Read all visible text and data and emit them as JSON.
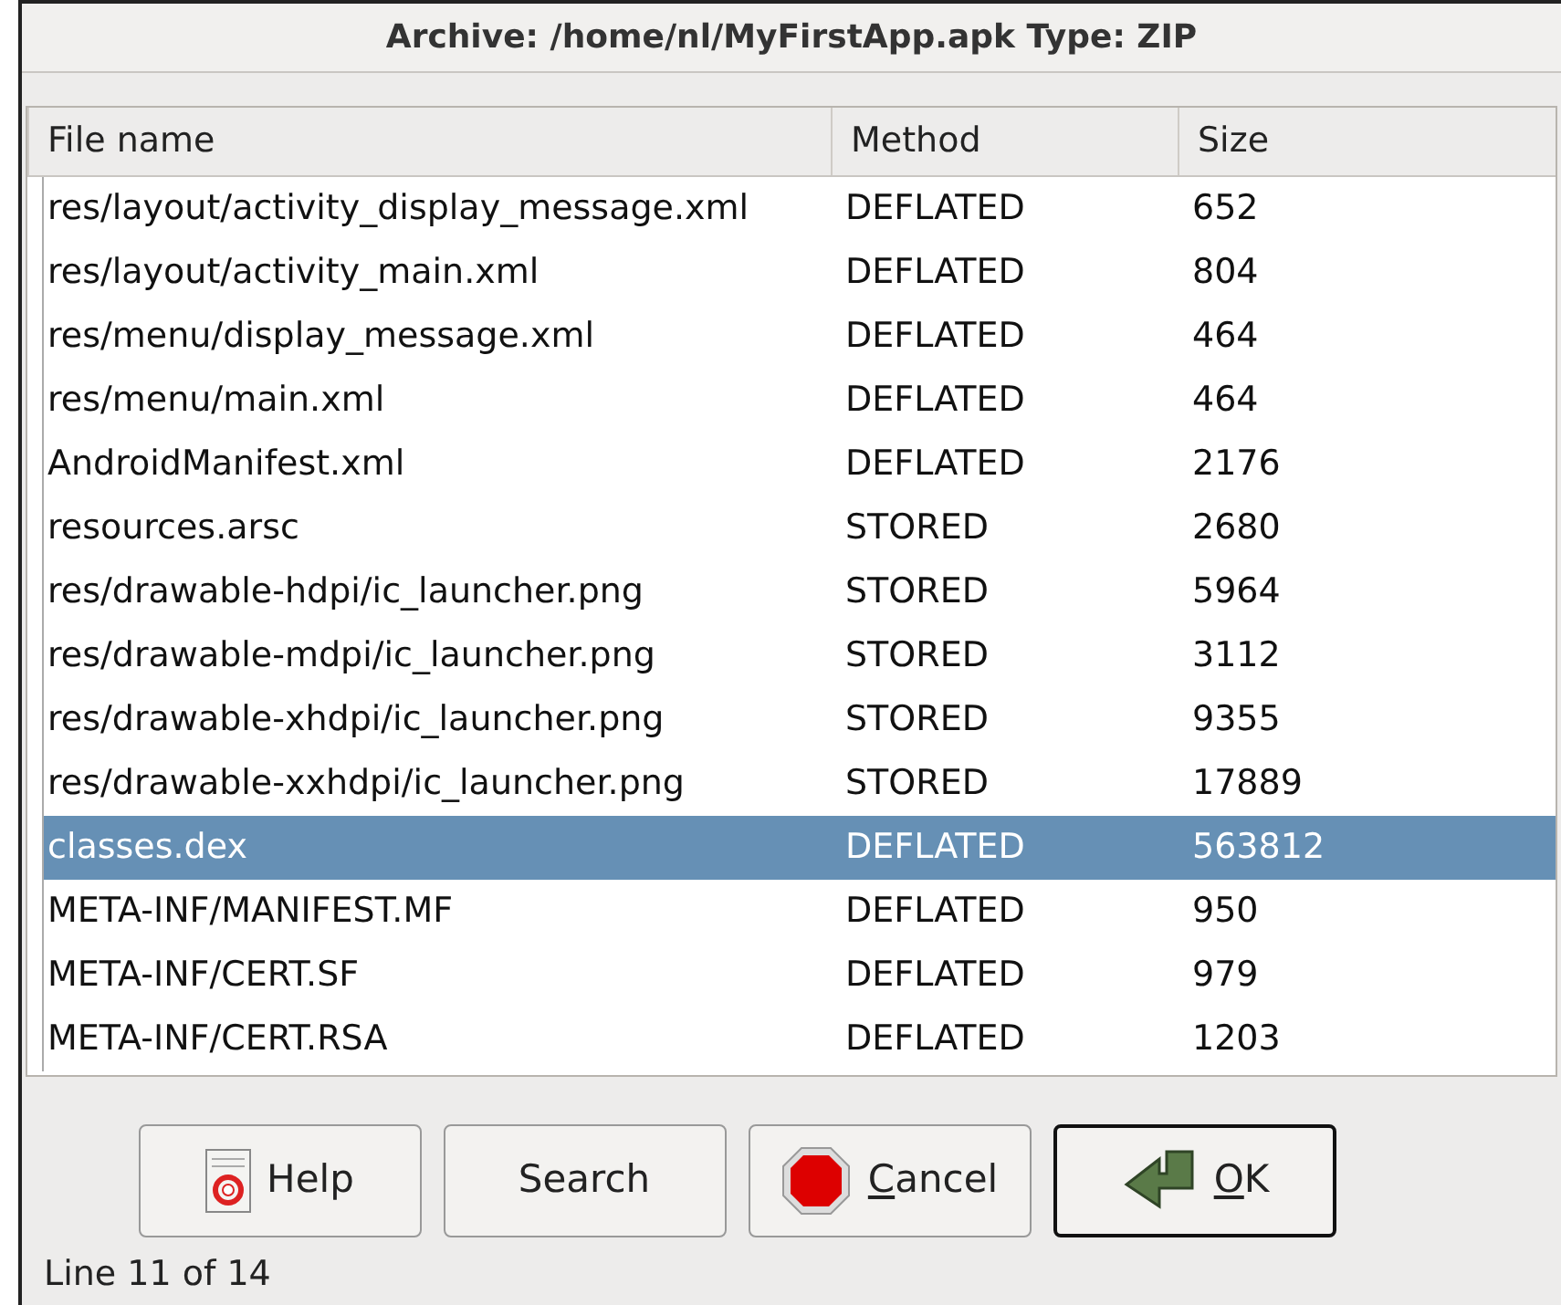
{
  "window": {
    "title": "Archive: /home/nl/MyFirstApp.apk Type: ZIP"
  },
  "table": {
    "columns": [
      "File name",
      "Method",
      "Size"
    ],
    "rows": [
      {
        "cells": [
          "res/layout/activity_display_message.xml",
          "DEFLATED",
          "652"
        ],
        "selected": false
      },
      {
        "cells": [
          "res/layout/activity_main.xml",
          "DEFLATED",
          "804"
        ],
        "selected": false
      },
      {
        "cells": [
          "res/menu/display_message.xml",
          "DEFLATED",
          "464"
        ],
        "selected": false
      },
      {
        "cells": [
          "res/menu/main.xml",
          "DEFLATED",
          "464"
        ],
        "selected": false
      },
      {
        "cells": [
          "AndroidManifest.xml",
          "DEFLATED",
          "2176"
        ],
        "selected": false
      },
      {
        "cells": [
          "resources.arsc",
          "STORED",
          "2680"
        ],
        "selected": false
      },
      {
        "cells": [
          "res/drawable-hdpi/ic_launcher.png",
          "STORED",
          "5964"
        ],
        "selected": false
      },
      {
        "cells": [
          "res/drawable-mdpi/ic_launcher.png",
          "STORED",
          "3112"
        ],
        "selected": false
      },
      {
        "cells": [
          "res/drawable-xhdpi/ic_launcher.png",
          "STORED",
          "9355"
        ],
        "selected": false
      },
      {
        "cells": [
          "res/drawable-xxhdpi/ic_launcher.png",
          "STORED",
          "17889"
        ],
        "selected": false
      },
      {
        "cells": [
          "classes.dex",
          "DEFLATED",
          "563812"
        ],
        "selected": true
      },
      {
        "cells": [
          "META-INF/MANIFEST.MF",
          "DEFLATED",
          "950"
        ],
        "selected": false
      },
      {
        "cells": [
          "META-INF/CERT.SF",
          "DEFLATED",
          "979"
        ],
        "selected": false
      },
      {
        "cells": [
          "META-INF/CERT.RSA",
          "DEFLATED",
          "1203"
        ],
        "selected": false
      }
    ]
  },
  "buttons": [
    {
      "label": "Help",
      "kind": "help",
      "underline_first": false,
      "default": false
    },
    {
      "label": "Search",
      "kind": "plain",
      "underline_first": false,
      "default": false
    },
    {
      "label": "Cancel",
      "kind": "cancel",
      "underline_first": true,
      "default": false
    },
    {
      "label": "OK",
      "kind": "ok",
      "underline_first": true,
      "default": true
    }
  ],
  "status_bar": "Line 11 of 14"
}
